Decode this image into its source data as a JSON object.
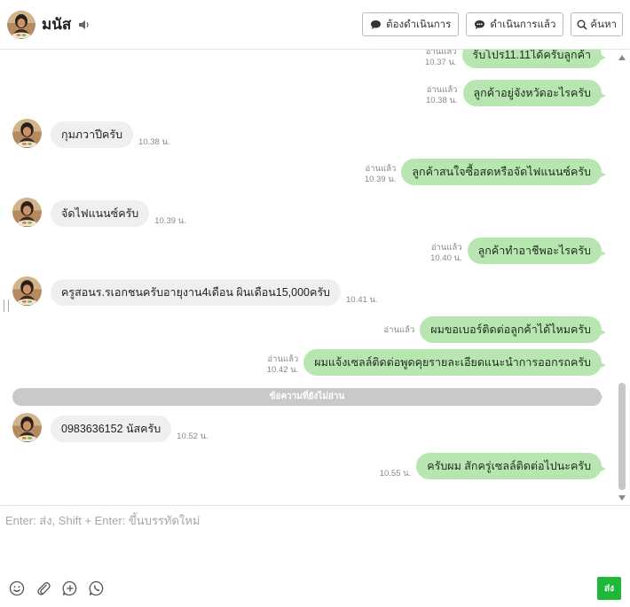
{
  "header": {
    "contact_name": "มนัส",
    "btn_pending": "ต้องดำเนินการ",
    "btn_done": "ดำเนินการแล้ว",
    "btn_search": "ค้นหา"
  },
  "messages": [
    {
      "dir": "out",
      "text": "รับโปร11.11ได้ครับลูกค้า",
      "read": "อ่านแล้ว",
      "time": "10.37 น."
    },
    {
      "dir": "out",
      "text": "ลูกค้าอยู่จังหวัดอะไรครับ",
      "read": "อ่านแล้ว",
      "time": "10.38 น."
    },
    {
      "dir": "in",
      "text": "กุมภวาปีครับ",
      "time": "10.38 น."
    },
    {
      "dir": "out",
      "text": "ลูกค้าสนใจซื้อสดหรือจัดไฟแนนซ์ครับ",
      "read": "อ่านแล้ว",
      "time": "10.39 น."
    },
    {
      "dir": "in",
      "text": "จัดไฟแนนซ์ครับ",
      "time": "10.39 น."
    },
    {
      "dir": "out",
      "text": "ลูกค้าทำอาชีพอะไรครับ",
      "read": "อ่านแล้ว",
      "time": "10.40 น."
    },
    {
      "dir": "in",
      "text": "ครูสอนร.รเอกชนครับอายุงาน4เดือน ผินเดือน15,000ครับ",
      "time": "10.41 น."
    },
    {
      "dir": "out",
      "text": "ผมขอเบอร์ติดต่อลูกค้าได้ไหมครับ",
      "read": "อ่านแล้ว",
      "time": ""
    },
    {
      "dir": "out",
      "text": "ผมแจ้งเซลล์ติดต่อพูดคุยรายละเอียดแนะนำการออกรถครับ",
      "read": "อ่านแล้ว",
      "time": "10.42 น."
    },
    {
      "dir": "in",
      "text": "0983636152 นัสครับ",
      "time": "10.52 น."
    },
    {
      "dir": "out",
      "text": "ครับผม สักครู่เซลล์ติดต่อไปนะครับ",
      "read": "",
      "time": "10.55 น."
    }
  ],
  "unread_label": "ข้อความที่ยังไม่อ่าน",
  "composer": {
    "placeholder": "Enter: ส่ง, Shift + Enter: ขึ้นบรรทัดใหม่",
    "send_label": "ส่ง"
  },
  "icons": {
    "speaker": "speaker-icon",
    "pending": "chat-bubble-icon",
    "done": "chat-bubble-dots-icon",
    "search": "search-icon",
    "emoji": "smiley-icon",
    "attach": "paperclip-icon",
    "plus": "plus-circle-icon",
    "phone": "whatsapp-phone-icon"
  },
  "colors": {
    "outgoing_bubble": "#b8e6b0",
    "incoming_bubble": "#efefef",
    "send_button": "#1dba3a",
    "unread_bar": "#c9c9c9"
  }
}
